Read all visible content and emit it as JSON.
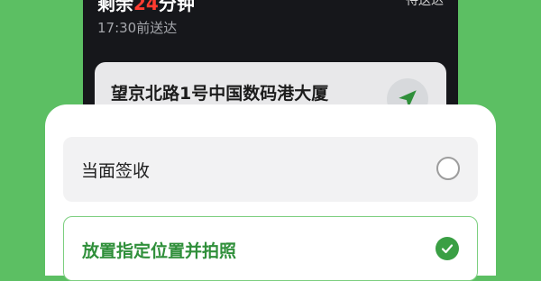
{
  "phone": {
    "countdown_prefix": "剩余",
    "countdown_number": "24",
    "countdown_suffix": "分钟",
    "status_right": "待送达",
    "deliver_time": "17:30前送达",
    "address": "望京北路1号中国数码港大厦"
  },
  "sheet": {
    "options": [
      {
        "label": "当面签收",
        "selected": false
      },
      {
        "label": "放置指定位置并拍照",
        "selected": true
      }
    ]
  },
  "colors": {
    "background": "#5cbf63",
    "accent_green": "#3a9f44",
    "highlight_red": "#ff3b30"
  }
}
